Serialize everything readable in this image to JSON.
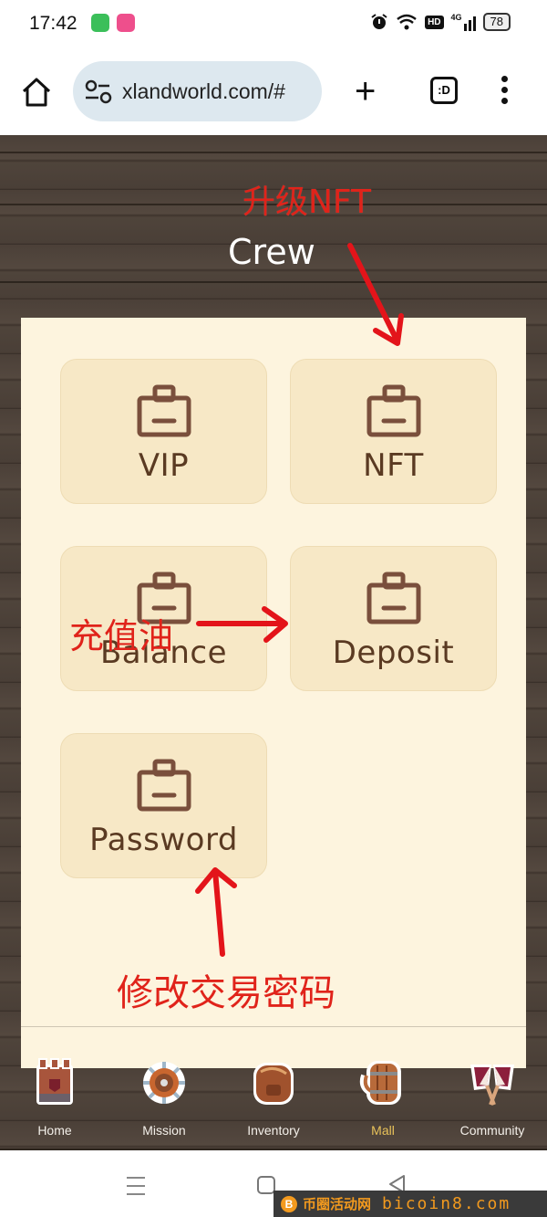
{
  "status_bar": {
    "time": "17:42",
    "app_badges": [
      {
        "name": "messages-app-icon",
        "color": "#3bbf5a"
      },
      {
        "name": "social-app-icon",
        "color": "#ee4f8c"
      }
    ],
    "indicators": [
      "alarm-icon",
      "wifi-icon",
      "hd-icon",
      "signal-4g-icon"
    ],
    "hd_label": "HD",
    "network_label": "4G",
    "battery": "78"
  },
  "browser": {
    "url": "xlandworld.com/#",
    "tab_count_label": ":D"
  },
  "page": {
    "title": "Crew",
    "tiles": [
      {
        "label": "VIP",
        "icon": "shopping-bag-icon"
      },
      {
        "label": "NFT",
        "icon": "shopping-bag-icon"
      },
      {
        "label": "Balance",
        "icon": "shopping-bag-icon"
      },
      {
        "label": "Deposit",
        "icon": "shopping-bag-icon"
      },
      {
        "label": "Password",
        "icon": "shopping-bag-icon"
      }
    ]
  },
  "annotations": {
    "upgrade_nft": "升级NFT",
    "recharge": "充值油",
    "change_password": "修改交易密码",
    "color": "#e0231a"
  },
  "bottom_nav": {
    "active": "Mall",
    "active_color": "#e8c25a",
    "items": [
      {
        "label": "Home",
        "icon": "tower-icon"
      },
      {
        "label": "Mission",
        "icon": "ship-wheel-icon"
      },
      {
        "label": "Inventory",
        "icon": "backpack-icon"
      },
      {
        "label": "Mall",
        "icon": "beer-mug-icon"
      },
      {
        "label": "Community",
        "icon": "flags-icon"
      }
    ]
  },
  "watermark": {
    "coin": "B",
    "cn": "币圈活动网",
    "en": "bicoin8.com"
  }
}
